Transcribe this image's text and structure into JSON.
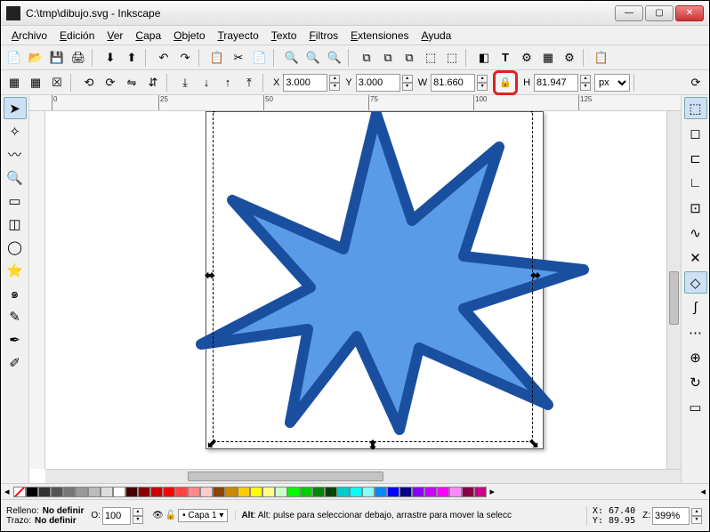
{
  "title": "C:\\tmp\\dibujo.svg - Inkscape",
  "menu": [
    "Archivo",
    "Edición",
    "Ver",
    "Capa",
    "Objeto",
    "Trayecto",
    "Texto",
    "Filtros",
    "Extensiones",
    "Ayuda"
  ],
  "coords": {
    "X": "3.000",
    "Y": "3.000",
    "W": "81.660",
    "H": "81.947"
  },
  "unit": "px",
  "palette_colors": [
    "none",
    "#000",
    "#333",
    "#555",
    "#777",
    "#999",
    "#bbb",
    "#ddd",
    "#fff",
    "#400",
    "#800",
    "#c00",
    "#f00",
    "#f44",
    "#f88",
    "#fcc",
    "#840",
    "#c80",
    "#fc0",
    "#ff0",
    "#ff8",
    "#cfc",
    "#0f0",
    "#0c0",
    "#080",
    "#040",
    "#0cc",
    "#0ff",
    "#8ff",
    "#08f",
    "#00f",
    "#008",
    "#80f",
    "#c0f",
    "#f0f",
    "#f8f",
    "#804",
    "#c08"
  ],
  "status": {
    "fill_label": "Relleno:",
    "fill_value": "No definir",
    "stroke_label": "Trazo:",
    "stroke_value": "No definir",
    "opacity_label": "O:",
    "opacity": "100",
    "layer": "Capa 1",
    "message": "Alt: pulse para seleccionar debajo, arrastre para mover la selecc",
    "X_label": "X:",
    "X": "67.40",
    "Y_label": "Y:",
    "Y": "89.95",
    "Z_label": "Z:",
    "Z": "399%"
  },
  "ruler_ticks": [
    {
      "p": 25,
      "l": "0"
    },
    {
      "p": 145,
      "l": "25"
    },
    {
      "p": 263,
      "l": "50"
    },
    {
      "p": 381,
      "l": "75"
    },
    {
      "p": 499,
      "l": "100"
    },
    {
      "p": 617,
      "l": "125"
    }
  ]
}
